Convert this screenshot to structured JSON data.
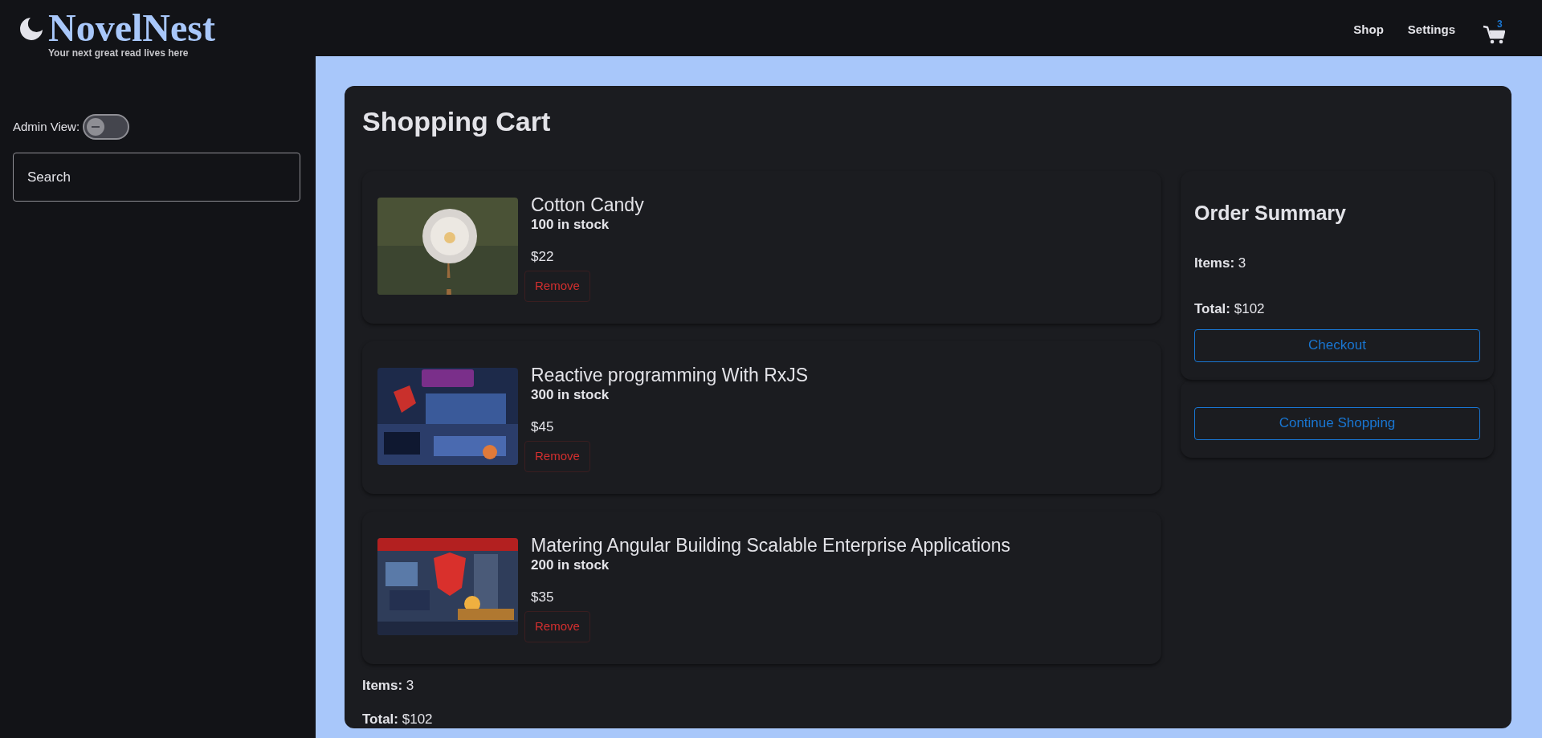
{
  "brand": {
    "name": "NovelNest",
    "tagline": "Your next great read lives here"
  },
  "nav": {
    "links": [
      "Shop",
      "Settings"
    ],
    "cart_count": "3"
  },
  "sidebar": {
    "admin_label": "Admin View:",
    "admin_toggle": {
      "checked": false
    },
    "search": {
      "placeholder": "Search"
    }
  },
  "cart": {
    "title": "Shopping Cart",
    "items": [
      {
        "title": "Cotton Candy",
        "stock": "100 in stock",
        "price": "$22",
        "remove": "Remove"
      },
      {
        "title": "Reactive programming With RxJS",
        "stock": "300 in stock",
        "price": "$45",
        "remove": "Remove"
      },
      {
        "title": "Matering Angular Building Scalable Enterprise Applications",
        "stock": "200 in stock",
        "price": "$35",
        "remove": "Remove"
      }
    ],
    "items_line": "**Items:** 3",
    "total_line": "**Total:** $102"
  },
  "summary": {
    "title": "Order Summary",
    "items_line": "**Items:** 3",
    "total_line": "**Total:** $102",
    "checkout": "Checkout",
    "continue": "Continue Shopping"
  }
}
